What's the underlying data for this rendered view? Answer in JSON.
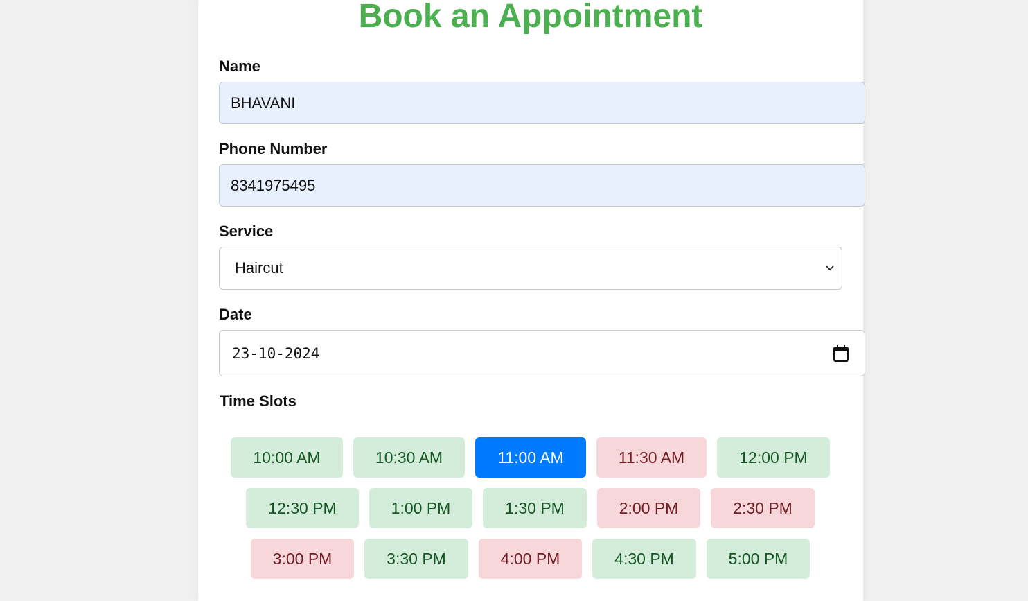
{
  "page": {
    "title": "Book an Appointment"
  },
  "form": {
    "name": {
      "label": "Name",
      "value": "BHAVANI"
    },
    "phone": {
      "label": "Phone Number",
      "value": "8341975495"
    },
    "service": {
      "label": "Service",
      "value": "Haircut"
    },
    "date": {
      "label": "Date",
      "value": "23-10-2024"
    }
  },
  "slots": {
    "title": "Time Slots",
    "items": [
      {
        "label": "10:00 AM",
        "status": "available"
      },
      {
        "label": "10:30 AM",
        "status": "available"
      },
      {
        "label": "11:00 AM",
        "status": "selected"
      },
      {
        "label": "11:30 AM",
        "status": "booked"
      },
      {
        "label": "12:00 PM",
        "status": "available"
      },
      {
        "label": "12:30 PM",
        "status": "available"
      },
      {
        "label": "1:00 PM",
        "status": "available"
      },
      {
        "label": "1:30 PM",
        "status": "available"
      },
      {
        "label": "2:00 PM",
        "status": "booked"
      },
      {
        "label": "2:30 PM",
        "status": "booked"
      },
      {
        "label": "3:00 PM",
        "status": "booked"
      },
      {
        "label": "3:30 PM",
        "status": "available"
      },
      {
        "label": "4:00 PM",
        "status": "booked"
      },
      {
        "label": "4:30 PM",
        "status": "available"
      },
      {
        "label": "5:00 PM",
        "status": "available"
      }
    ]
  },
  "colors": {
    "title": "#4caf50",
    "available_bg": "#d4edda",
    "booked_bg": "#f8d7da",
    "selected_bg": "#007bff",
    "filled_input_bg": "#e8f0fe"
  },
  "icons": {
    "select_arrow": "chevron-down-icon",
    "date_picker": "calendar-icon"
  }
}
